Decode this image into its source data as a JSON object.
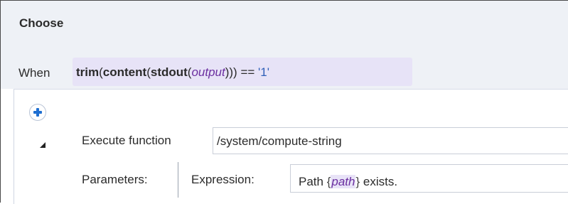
{
  "choose": {
    "title": "Choose"
  },
  "when": {
    "label": "When",
    "expression": {
      "fn_trim": "trim",
      "paren1": "(",
      "fn_content": "content",
      "paren2": "(",
      "fn_stdout": "stdout",
      "paren3": "(",
      "var_output": "output",
      "close": ")))",
      "op": " == ",
      "literal": "'1'"
    }
  },
  "execute": {
    "label": "Execute function",
    "value": "/system/compute-string"
  },
  "parameters": {
    "label": "Parameters:",
    "name": "Expression:",
    "value": {
      "prefix": "Path ",
      "open_brace": "{",
      "var": "path",
      "close_brace": "}",
      "suffix": " exists."
    }
  },
  "icons": {
    "add": "plus-icon",
    "toggle": "collapse-triangle-icon"
  },
  "colors": {
    "add_icon": "#1f6fd1",
    "expression_bg": "#e7e3f7",
    "header_bg": "#eef1f6"
  }
}
